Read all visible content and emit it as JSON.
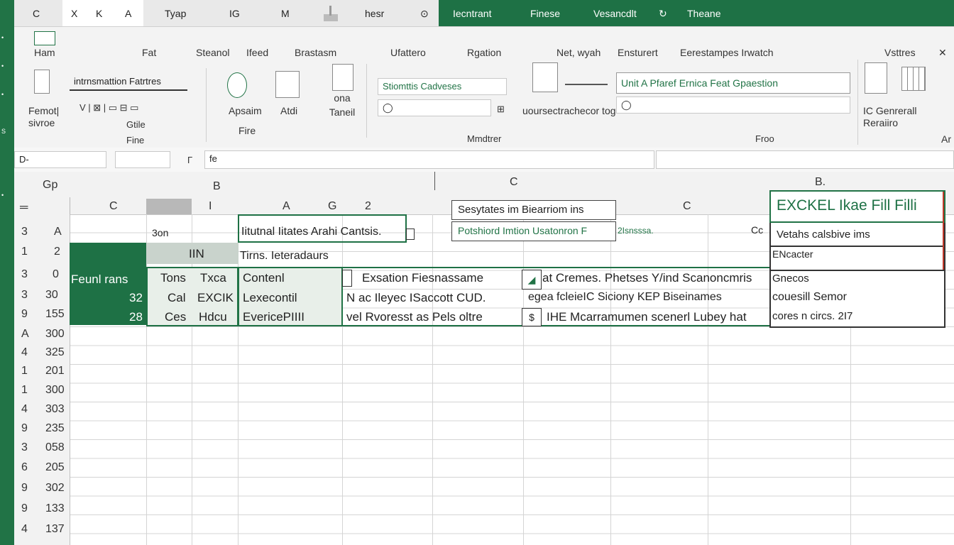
{
  "topbar": {
    "tabs": [
      "C",
      "X",
      "K",
      "A",
      "Tyap",
      "IG",
      "M",
      "hesr",
      "Iecntrant",
      "Finese",
      "Vesancdlt",
      "Theane"
    ]
  },
  "ribbon": {
    "groups": [
      "Ham",
      "Fat",
      "Steanol",
      "Ifeed",
      "Brastasm",
      "Ufattero",
      "Rgation",
      "Net, wyah",
      "Ensturert",
      "Eerestampes Irwatch",
      "Vsttres"
    ],
    "format_label": "Femot| sivroe",
    "info_field": "intrnsmattion Fatrtres",
    "cite_label": "Gtile",
    "fine_label": "Fine",
    "apr_label": "Apsaim",
    "atdi_label": "Atdi",
    "ona_label": "ona Taneil",
    "fire_label": "Fire",
    "style_field": "Stiomttis Cadveses",
    "mmd_label": "Mmdtrer",
    "unrest_label": "uoursectrachecor tog",
    "formula_field": "Unit A Pfaref Ernica Feat Gpaestion",
    "froo_label": "Froo",
    "cen_label": "IC Genrerall Reraiiro",
    "ar_label": "Ar"
  },
  "formula_bar": {
    "name_box": "D-",
    "fx": "fe"
  },
  "column_headers": [
    "Gp",
    "B",
    "C",
    "B.",
    "C",
    "I",
    "A",
    "G",
    "2",
    "C",
    "C"
  ],
  "row_numbers": [
    [
      "3",
      "A"
    ],
    [
      "1",
      "2"
    ],
    [
      "3",
      "0"
    ],
    [
      "3",
      "30"
    ],
    [
      "9",
      "155"
    ],
    [
      "A",
      "300"
    ],
    [
      "4",
      "325"
    ],
    [
      "1",
      "201"
    ],
    [
      "1",
      "300"
    ],
    [
      "4",
      "303"
    ],
    [
      "9",
      "235"
    ],
    [
      "3",
      "058"
    ],
    [
      "6",
      "205"
    ],
    [
      "9",
      "302"
    ],
    [
      "9",
      "133"
    ],
    [
      "4",
      "137"
    ]
  ],
  "green_block": {
    "line1": "Feunl rans",
    "line2": "32",
    "line3": "28"
  },
  "cells": {
    "r1_son": "3on",
    "r1_intr": "Iitutnal Iitates Arahi Cantsis.",
    "r2_hdr": "IIN",
    "r2_tms": "Tirns. Ieteradaurs",
    "r3_tone": "Tons",
    "r3_exca": "Txca",
    "r3_cont": "Contenl",
    "r3_exec": "Exsation Fiesnassame",
    "r3_at": "at Cremes. Phetses Y/ind Scanoncmris",
    "r4_cal": "Cal",
    "r4_exck": "EXCIK",
    "r4_loca": "Lexecontil",
    "r4_nac": "N ac Ileyec ISaccott CUD.",
    "r4_sea": "egea fcleieIC Siciony KEP Biseinames",
    "r5_ces": "Ces",
    "r5_hdc": "Hdcu",
    "r5_evel": "EvericePIIII",
    "r5_wel": "vel Rvoresst as Pels oltre",
    "r5_ihe": "IHE Mcarramumen scenerl Lubey hat"
  },
  "tooltip": {
    "title": "Sesytates im Biearriom ins",
    "subtitle": "Potshiord Imtion Usatonron F",
    "small": "2Isnsssa."
  },
  "excel_panel": {
    "title": "EXCKEL Ikae Fill Filli",
    "row1": "Vetahs calsbive ims",
    "row2": "ENcacter",
    "row3": "Gnecos",
    "row4": "couesill Semor",
    "row5": "cores n circs. 2I7"
  }
}
